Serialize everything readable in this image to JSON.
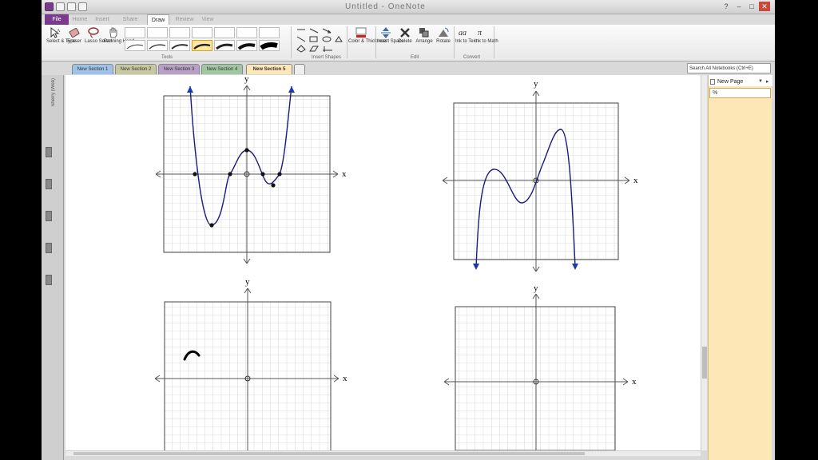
{
  "app": {
    "title": "Untitled - OneNote",
    "colors": {
      "accent": "#7b3b8c",
      "curve": "#1a1a7a",
      "page_pane": "#fde7b7"
    }
  },
  "ribbon": {
    "tabs": [
      "File",
      "Home",
      "Insert",
      "Share",
      "Draw",
      "Review",
      "View"
    ],
    "active_tab": "Draw",
    "buttons": {
      "select": "Select & Type",
      "eraser": "Eraser",
      "lasso": "Lasso Select",
      "panning": "Panning Hand",
      "color": "Color & Thickness",
      "insert_space": "Insert Space",
      "delete": "Delete",
      "arrange": "Arrange",
      "rotate": "Rotate",
      "ink_text": "Ink to Text",
      "ink_math": "Ink to Math"
    },
    "groups": {
      "tools": "Tools",
      "shapes": "Insert Shapes",
      "edit": "Edit",
      "convert": "Convert"
    }
  },
  "sections": [
    "New Section 1",
    "New Section 2",
    "New Section 3",
    "New Section 4",
    "New Section 5"
  ],
  "active_section": "New Section 5",
  "search": {
    "placeholder": "Search All Notebooks (Ctrl+E)"
  },
  "sidebar": {
    "notebook": "Sherry (Web)"
  },
  "page_pane": {
    "new_page": "New Page",
    "entry": "%"
  },
  "graphs": {
    "x_label": "x",
    "y_label": "y"
  }
}
